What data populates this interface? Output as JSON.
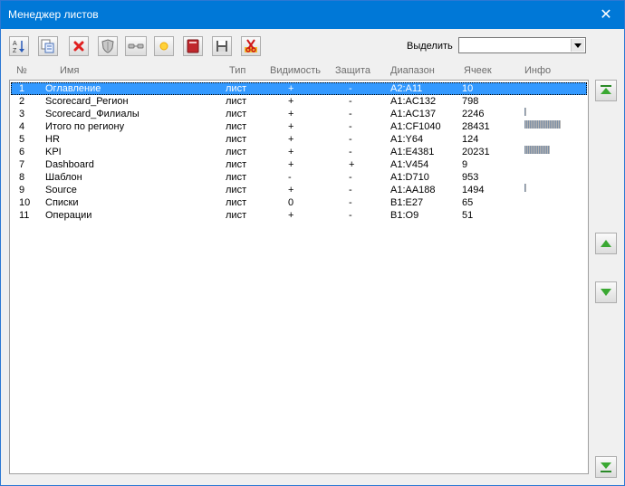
{
  "window": {
    "title": "Менеджер листов",
    "close_glyph": "✕"
  },
  "toolbar": {
    "buttons": [
      {
        "name": "sort-az-button",
        "icon": "sort-az-icon"
      },
      {
        "name": "copy-sheet-button",
        "icon": "copy-icon"
      },
      {
        "name": "delete-sheet-button",
        "icon": "delete-icon"
      },
      {
        "name": "protect-sheet-button",
        "icon": "shield-icon"
      },
      {
        "name": "visibility-button",
        "icon": "glasses-icon"
      },
      {
        "name": "new-sheet-button",
        "icon": "star-icon"
      },
      {
        "name": "book-button",
        "icon": "book-icon"
      },
      {
        "name": "save-button",
        "icon": "floppy-icon"
      },
      {
        "name": "cut-button",
        "icon": "scissors-icon"
      }
    ],
    "select_label": "Выделить",
    "select_value": ""
  },
  "columns": {
    "num": "№",
    "name": "Имя",
    "type": "Тип",
    "visibility": "Видимость",
    "protection": "Защита",
    "range": "Диапазон",
    "cells": "Ячеек",
    "info": "Инфо"
  },
  "rows": [
    {
      "num": "1",
      "name": "Оглавление",
      "type": "лист",
      "visibility": "+",
      "protection": "-",
      "range": "A2:A11",
      "cells": "10",
      "info_level": 0,
      "selected": true
    },
    {
      "num": "2",
      "name": "Scorecard_Регион",
      "type": "лист",
      "visibility": "+",
      "protection": "-",
      "range": "A1:AC132",
      "cells": "798",
      "info_level": 0,
      "selected": false
    },
    {
      "num": "3",
      "name": "Scorecard_Филиалы",
      "type": "лист",
      "visibility": "+",
      "protection": "-",
      "range": "A1:AC137",
      "cells": "2246",
      "info_level": 0.05,
      "selected": false
    },
    {
      "num": "4",
      "name": "Итого по региону",
      "type": "лист",
      "visibility": "+",
      "protection": "-",
      "range": "A1:CF1040",
      "cells": "28431",
      "info_level": 1,
      "selected": false
    },
    {
      "num": "5",
      "name": "HR",
      "type": "лист",
      "visibility": "+",
      "protection": "-",
      "range": "A1:Y64",
      "cells": "124",
      "info_level": 0,
      "selected": false
    },
    {
      "num": "6",
      "name": "KPI",
      "type": "лист",
      "visibility": "+",
      "protection": "-",
      "range": "A1:E4381",
      "cells": "20231",
      "info_level": 0.71,
      "selected": false
    },
    {
      "num": "7",
      "name": "Dashboard",
      "type": "лист",
      "visibility": "+",
      "protection": "+",
      "range": "A1:V454",
      "cells": "9",
      "info_level": 0,
      "selected": false
    },
    {
      "num": "8",
      "name": "Шаблон",
      "type": "лист",
      "visibility": "-",
      "protection": "-",
      "range": "A1:D710",
      "cells": "953",
      "info_level": 0,
      "selected": false
    },
    {
      "num": "9",
      "name": "Source",
      "type": "лист",
      "visibility": "+",
      "protection": "-",
      "range": "A1:AA188",
      "cells": "1494",
      "info_level": 0.05,
      "selected": false
    },
    {
      "num": "10",
      "name": "Списки",
      "type": "лист",
      "visibility": "0",
      "protection": "-",
      "range": "B1:E27",
      "cells": "65",
      "info_level": 0,
      "selected": false
    },
    {
      "num": "11",
      "name": "Операции",
      "type": "лист",
      "visibility": "+",
      "protection": "-",
      "range": "B1:O9",
      "cells": "51",
      "info_level": 0,
      "selected": false
    }
  ],
  "side_buttons": [
    {
      "name": "move-top-button",
      "icon": "arrow-top-icon"
    },
    {
      "name": "move-up-button",
      "icon": "arrow-up-icon"
    },
    {
      "name": "move-down-button",
      "icon": "arrow-down-icon"
    },
    {
      "name": "move-bottom-button",
      "icon": "arrow-bottom-icon"
    }
  ],
  "colors": {
    "accent": "#0078d7",
    "selection": "#3399ff",
    "arrow_green": "#3aa832"
  }
}
